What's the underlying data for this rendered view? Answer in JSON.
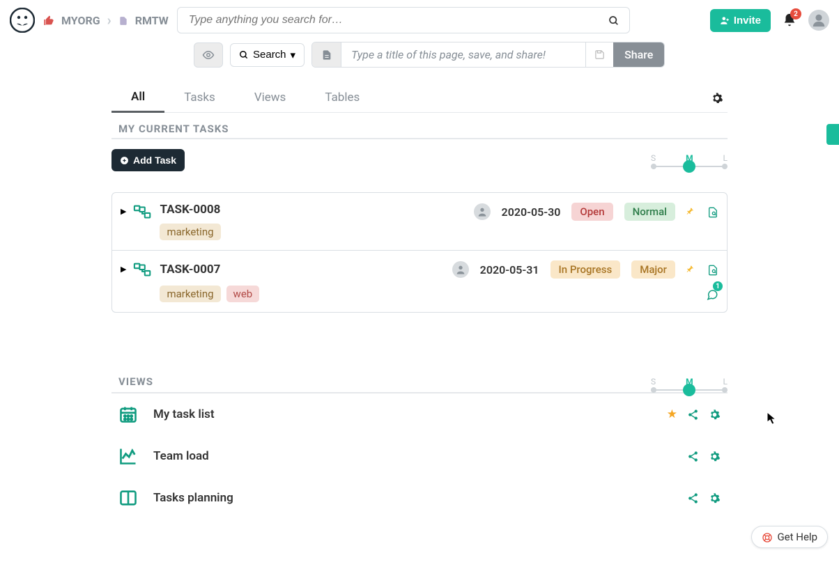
{
  "breadcrumb": {
    "org": "MYORG",
    "page": "RMTW"
  },
  "search": {
    "placeholder": "Type anything you search for…"
  },
  "invite": "Invite",
  "notifications": 2,
  "toolbar": {
    "search": "Search",
    "title_placeholder": "Type a title of this page, save, and share!",
    "share": "Share"
  },
  "tabs": [
    "All",
    "Tasks",
    "Views",
    "Tables"
  ],
  "active_tab": 0,
  "section_tasks": "MY CURRENT TASKS",
  "add_task": "Add Task",
  "size_options": [
    "S",
    "M",
    "L"
  ],
  "size_active": 1,
  "tasks": [
    {
      "id": "TASK-0008",
      "tags": [
        "marketing"
      ],
      "date": "2020-05-30",
      "status": "Open",
      "priority": "Normal",
      "status_class": "open",
      "priority_class": "normal",
      "comments": null
    },
    {
      "id": "TASK-0007",
      "tags": [
        "marketing",
        "web"
      ],
      "date": "2020-05-31",
      "status": "In Progress",
      "priority": "Major",
      "status_class": "progress",
      "priority_class": "major",
      "comments": 1
    }
  ],
  "section_views": "VIEWS",
  "views": [
    {
      "name": "My task list",
      "starred": true,
      "icon": "calendar"
    },
    {
      "name": "Team load",
      "starred": false,
      "icon": "chart"
    },
    {
      "name": "Tasks planning",
      "starred": false,
      "icon": "columns"
    }
  ],
  "help": "Get Help"
}
